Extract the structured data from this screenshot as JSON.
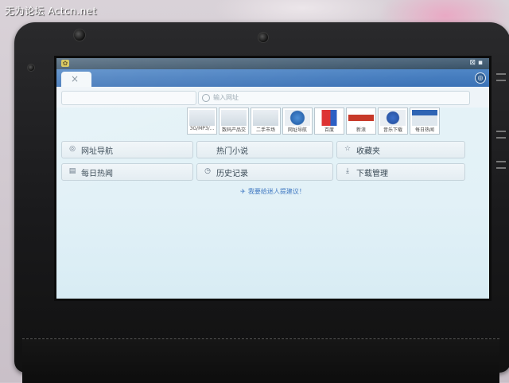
{
  "watermark": "无为论坛 Actcn.net",
  "status_bar": {
    "app_icon": "notification-icon",
    "right_text": "⊠ ▪"
  },
  "tabs": {
    "active_tab": {
      "close_glyph": "×"
    },
    "menu_glyph": "◎"
  },
  "address": {
    "url_value": "",
    "search_placeholder": "输入网址"
  },
  "speed_dial": [
    {
      "label": "3G/MP3/..."
    },
    {
      "label": "数码产品交"
    },
    {
      "label": "二手市场"
    },
    {
      "label": "网址导航"
    },
    {
      "label": "百度"
    },
    {
      "label": "新浪"
    },
    {
      "label": "音乐下载"
    },
    {
      "label": "每日热闻"
    }
  ],
  "grid": [
    {
      "label": "网址导航",
      "icon": "globe-icon",
      "glyph": "◎"
    },
    {
      "label": "热门小说",
      "icon": "book-icon",
      "glyph": ""
    },
    {
      "label": "收藏夹",
      "icon": "star-icon",
      "glyph": "☆"
    },
    {
      "label": "每日热闻",
      "icon": "news-icon",
      "glyph": "▤"
    },
    {
      "label": "历史记录",
      "icon": "history-icon",
      "glyph": "◷"
    },
    {
      "label": "下载管理",
      "icon": "download-icon",
      "glyph": "⤓"
    }
  ],
  "feedback": {
    "icon": "airplane-icon",
    "glyph": "✈",
    "text": "我要给迷人提建议！"
  }
}
